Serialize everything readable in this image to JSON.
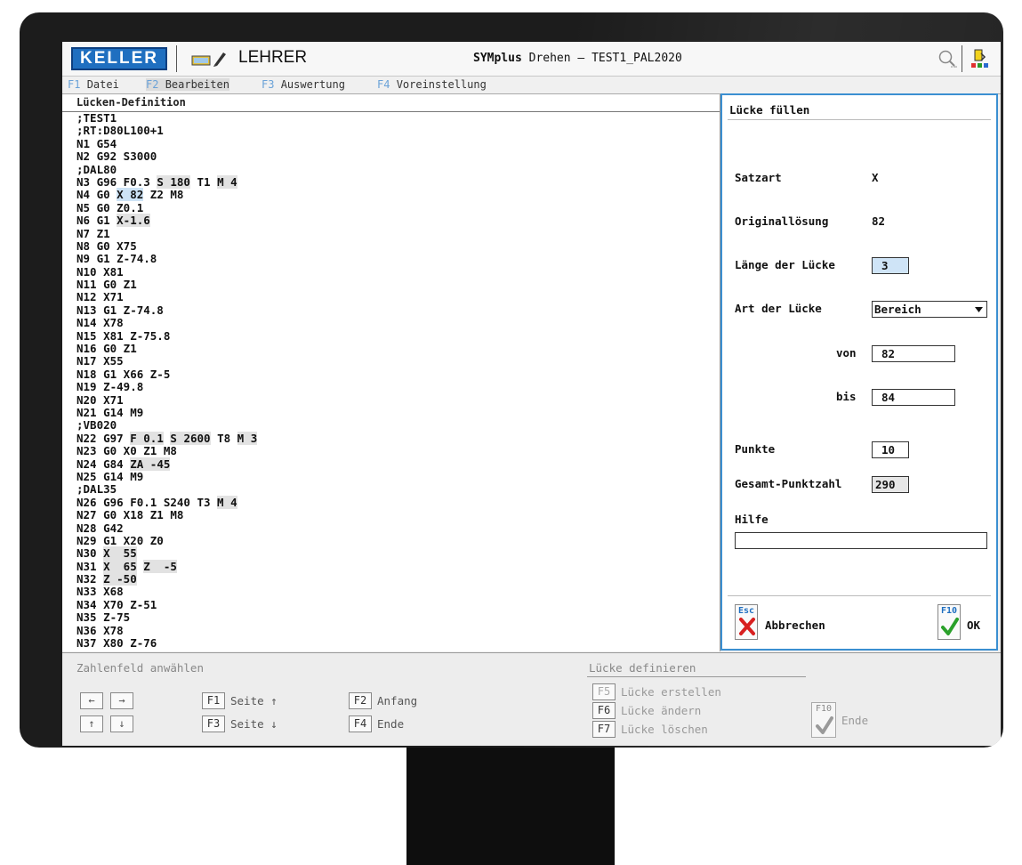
{
  "titlebar": {
    "logo": "KELLER",
    "user": "LEHRER",
    "app_name": "SYMplus",
    "app_title_rest": " Drehen – TEST1_PAL2020",
    "icons": [
      "pencil-icon",
      "search-icon",
      "exit-icon"
    ]
  },
  "menu": [
    {
      "key": "F1",
      "label": "Datei"
    },
    {
      "key": "F2",
      "label": "Bearbeiten",
      "active": true
    },
    {
      "key": "F3",
      "label": "Auswertung"
    },
    {
      "key": "F4",
      "label": "Voreinstellung"
    }
  ],
  "left_panel": {
    "title": "Lücken-Definition",
    "lines": [
      ";TEST1",
      ";RT:D80L100+1",
      "N1 G54",
      "N2 G92 S3000",
      ";DAL80",
      "N3 G96 F0.3 S 180 T1 M 4",
      "N4 G0 X 82 Z2 M8",
      "N5 G0 Z0.1",
      "N6 G1 X-1.6",
      "N7 Z1",
      "N8 G0 X75",
      "N9 G1 Z-74.8",
      "N10 X81",
      "N11 G0 Z1",
      "N12 X71",
      "N13 G1 Z-74.8",
      "N14 X78",
      "N15 X81 Z-75.8",
      "N16 G0 Z1",
      "N17 X55",
      "N18 G1 X66 Z-5",
      "N19 Z-49.8",
      "N20 X71",
      "N21 G14 M9",
      ";VB020",
      "N22 G97 F 0.1 S 2600 T8 M 3",
      "N23 G0 X0 Z1 M8",
      "N24 G84 ZA -45",
      "N25 G14 M9",
      ";DAL35",
      "N26 G96 F0.1 S240 T3 M 4",
      "N27 G0 X18 Z1 M8",
      "N28 G42",
      "N29 G1 X20 Z0",
      "N30 X  55",
      "N31 X  65 Z  -5",
      "N32 Z -50",
      "N33 X68",
      "N34 X70 Z-51",
      "N35 Z-75",
      "N36 X78",
      "N37 X80 Z-76"
    ]
  },
  "dialog": {
    "title": "Lücke füllen",
    "satzart_label": "Satzart",
    "satzart_value": "X",
    "original_label": "Originallösung",
    "original_value": "82",
    "laenge_label": "Länge der Lücke",
    "laenge_value": "3",
    "art_label": "Art der Lücke",
    "art_value": "Bereich",
    "von_label": "von",
    "von_value": "82",
    "bis_label": "bis",
    "bis_value": "84",
    "punkte_label": "Punkte",
    "punkte_value": "10",
    "gesamt_label": "Gesamt-Punktzahl",
    "gesamt_value": "290",
    "hilfe_label": "Hilfe",
    "hilfe_value": "",
    "cancel_key": "Esc",
    "cancel_label": "Abbrechen",
    "ok_key": "F10",
    "ok_label": "OK"
  },
  "bottombar": {
    "hint_left": "Zahlenfeld anwählen",
    "hint_right": "Lücke definieren",
    "arrows": [
      "←",
      "→",
      "↑",
      "↓"
    ],
    "keys": [
      {
        "key": "F1",
        "label": "Seite ↑"
      },
      {
        "key": "F3",
        "label": "Seite ↓"
      },
      {
        "key": "F2",
        "label": "Anfang"
      },
      {
        "key": "F4",
        "label": "Ende"
      },
      {
        "key": "F5",
        "label": "Lücke erstellen",
        "disabled": true
      },
      {
        "key": "F6",
        "label": "Lücke ändern",
        "disabled": false
      },
      {
        "key": "F7",
        "label": "Lücke löschen",
        "disabled": false
      }
    ],
    "end_key": "F10",
    "end_label": "Ende"
  },
  "colors": {
    "accent": "#3b8fd1",
    "logo": "#1f6fc0",
    "cancel": "#d82020",
    "ok": "#2aa02a"
  }
}
